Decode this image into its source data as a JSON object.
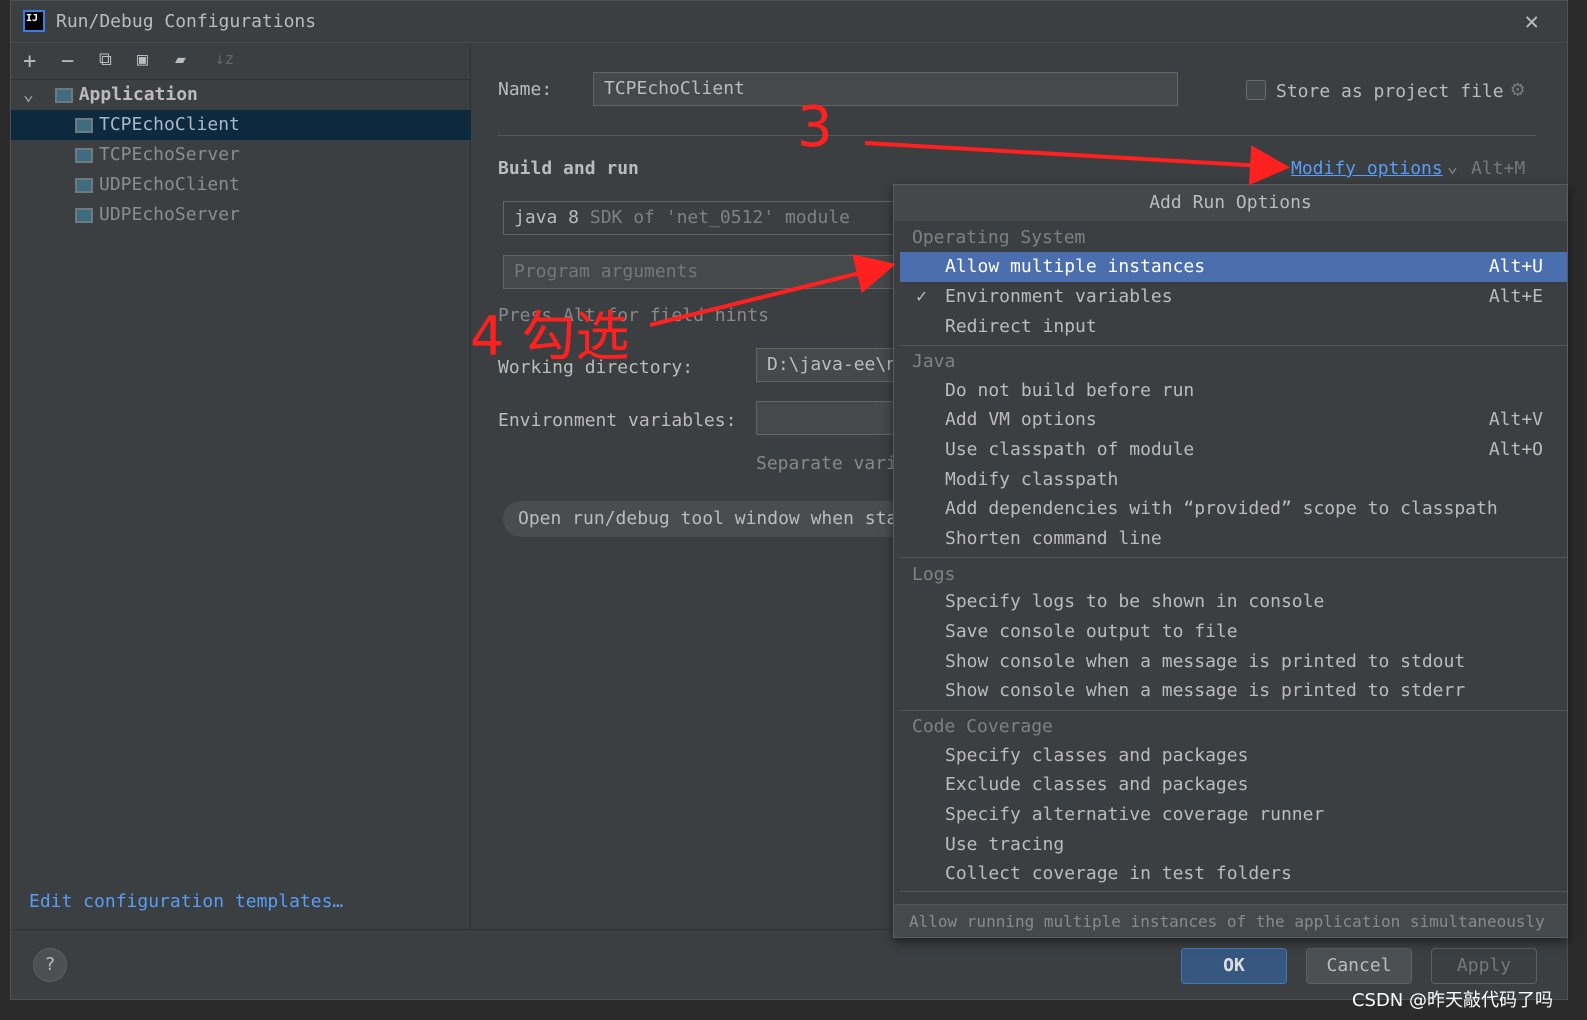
{
  "window": {
    "title": "Run/Debug Configurations",
    "close_icon": "close-icon"
  },
  "toolbar": {
    "icons": [
      "plus-icon",
      "minus-icon",
      "copy-icon",
      "save-icon",
      "new-folder-icon",
      "sort-icon"
    ]
  },
  "tree": {
    "group": "Application",
    "items": [
      "TCPEchoClient",
      "TCPEchoServer",
      "UDPEchoClient",
      "UDPEchoServer"
    ],
    "selected": "TCPEchoClient"
  },
  "left_link": "Edit configuration templates…",
  "form": {
    "name_label": "Name:",
    "name_value": "TCPEchoClient",
    "store_label": "Store as project file",
    "store_checked": false,
    "section": "Build and run",
    "modify_options": "Modify options",
    "modify_shortcut": "Alt+M",
    "sdk_value": "java 8",
    "sdk_hint": "SDK of 'net_0512' module",
    "program_args_placeholder": "Program arguments",
    "hint": "Press Alt for field hints",
    "workdir_label": "Working directory:",
    "workdir_value": "D:\\java-ee\\n",
    "env_label": "Environment variables:",
    "env_value": "",
    "env_hint": "Separate vari",
    "open_tool_window": "Open run/debug tool window when sta"
  },
  "popup": {
    "title": "Add Run Options",
    "sections": [
      {
        "label": "Operating System",
        "items": [
          {
            "label": "Allow multiple instances",
            "shortcut": "Alt+U",
            "highlighted": true
          },
          {
            "label": "Environment variables",
            "shortcut": "Alt+E",
            "checked": true
          },
          {
            "label": "Redirect input",
            "shortcut": ""
          }
        ]
      },
      {
        "label": "Java",
        "items": [
          {
            "label": "Do not build before run",
            "shortcut": ""
          },
          {
            "label": "Add VM options",
            "shortcut": "Alt+V"
          },
          {
            "label": "Use classpath of module",
            "shortcut": "Alt+O"
          },
          {
            "label": "Modify classpath",
            "shortcut": ""
          },
          {
            "label": "Add dependencies with “provided” scope to classpath",
            "shortcut": ""
          },
          {
            "label": "Shorten command line",
            "shortcut": ""
          }
        ]
      },
      {
        "label": "Logs",
        "items": [
          {
            "label": "Specify logs to be shown in console",
            "shortcut": ""
          },
          {
            "label": "Save console output to file",
            "shortcut": ""
          },
          {
            "label": "Show console when a message is printed to stdout",
            "shortcut": ""
          },
          {
            "label": "Show console when a message is printed to stderr",
            "shortcut": ""
          }
        ]
      },
      {
        "label": "Code Coverage",
        "items": [
          {
            "label": "Specify classes and packages",
            "shortcut": ""
          },
          {
            "label": "Exclude classes and packages",
            "shortcut": ""
          },
          {
            "label": "Specify alternative coverage runner",
            "shortcut": ""
          },
          {
            "label": "Use tracing",
            "shortcut": ""
          },
          {
            "label": "Collect coverage in test folders",
            "shortcut": ""
          }
        ]
      }
    ],
    "footer": "Allow running multiple instances of the application simultaneously"
  },
  "buttons": {
    "ok": "OK",
    "cancel": "Cancel",
    "apply": "Apply",
    "help": "?"
  },
  "annotations": {
    "step3": "3",
    "step4": "4 勾选",
    "color": "#ff2020"
  },
  "watermark": "CSDN @昨天敲代码了吗"
}
